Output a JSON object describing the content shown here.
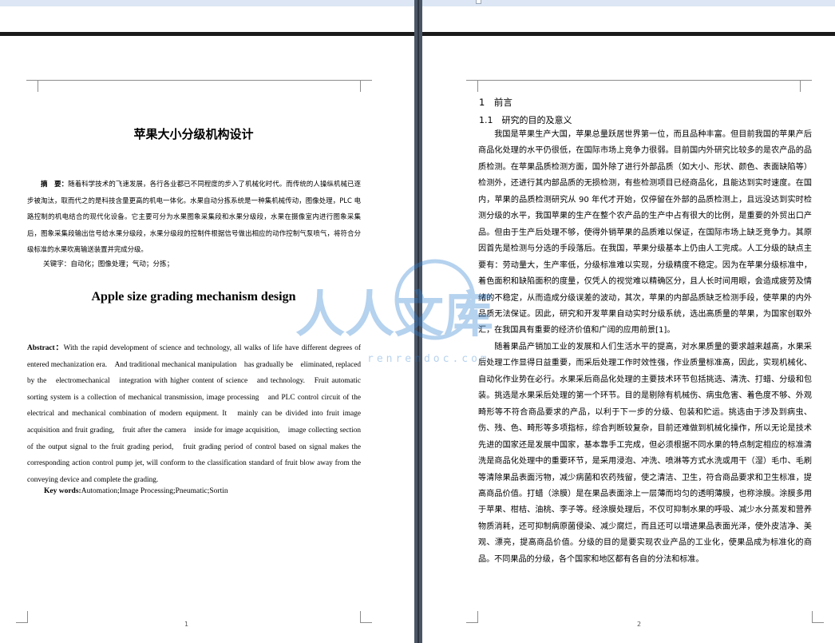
{
  "page1": {
    "title_cn": "苹果大小分级机构设计",
    "abstract_cn_label": "摘　要：",
    "abstract_cn": "随着科学技术的飞速发展，各行各业都已不同程度的步入了机械化时代。而传统的人操纵机械已逐步被淘汰，取而代之的是科技含量更高的机电一体化。水果自动分拣系统是一种集机械传动，图像处理，PLC 电路控制的机电结合的现代化设备。它主要可分为水果图象采集段和水果分级段，水果在摄像室内进行图象采集后，图象采集段输出信号给水果分级段，水果分级段的控制件根据信号做出相应的动作控制气泵喷气，将符合分级标准的水果吹离输送装置并完成分级。",
    "keywords_cn": "关键字：自动化；图像处理；气动；分拣；",
    "title_en": "Apple size grading mechanism design",
    "abstract_en_label": "Abstract：",
    "abstract_en": "With the rapid development of science and technology, all walks of life have different degrees of entered mechanization era.　And traditional mechanical manipulation　has gradually be　eliminated, replaced by the　electromechanical　integration with higher content of science　and technology.　Fruit automatic sorting system is a collection of mechanical transmission, image processing　and PLC control circuit of the electrical and mechanical combination of modern equipment. It　mainly can be divided into fruit image　acquisition and fruit grading,　fruit after the camera　inside for image acquisition,　image collecting section of the output signal to the fruit grading period,　fruit grading period of control based on signal makes the corresponding action control pump jet, will conform to the classification standard of fruit blow away from the conveying device and complete the grading.",
    "keywords_en_label": "Key words:",
    "keywords_en": "Automation;Image Processing;Pneumatic;Sortin",
    "page_number": "1"
  },
  "page2": {
    "heading1": "1　前言",
    "heading2": "1.1　研究的目的及意义",
    "para1": "我国是苹果生产大国，苹果总量跃居世界第一位，而且品种丰富。但目前我国的苹果产后商品化处理的水平仍很低，在国际市场上竞争力很弱。目前国内外研究比较多的是农产品的品质检测。在苹果品质检测方面，国外除了进行外部品质（如大小、形状、颜色、表面缺陷等）检测外，还进行其内部品质的无损检测，有些检测项目已经商品化，且能达到实时速度。在国内，苹果的品质检测研究从 90 年代才开始，仅停留在外部的品质检测上，且远没达到实时检测分级的水平，我国苹果的生产在整个农产品的生产中占有很大的比例，是重要的外贸出口产品。但由于生产后处理不够，使得外销苹果的品质难以保证，在国际市场上缺乏竞争力。其原因首先是检测与分选的手段落后。在我国，苹果分级基本上仍由人工完成。人工分级的缺点主要有：劳动量大，生产率低，分级标准难以实现，分级精度不稳定。因为在苹果分级标准中，着色面积和缺陷面积的度量，仅凭人的视觉难以精确区分，且人长时间用眼，会造成疲劳及情绪的不稳定，从而造成分级误差的波动，其次，苹果的内部品质缺乏检测手段，使苹果的内外品质无法保证。因此，研究和开发苹果自动实时分级系统，选出高质量的苹果，为国家创取外汇，在我国具有重要的经济价值和广阔的应用前景[1]。",
    "para2": "随着果品产销加工业的发展和人们生活水平的提高，对水果质量的要求越来越高，水果采后处理工作显得日益重要，而采后处理工作时效性强，作业质量标准高，因此，实现机械化、自动化作业势在必行。水果采后商品化处理的主要技术环节包括挑选、清洗、打蜡、分级和包装。挑选是水果采后处理的第一个环节。目的是剔除有机械伤、病虫危害、着色度不够、外观畸形等不符合商品要求的产品，以利于下一步的分级、包装和贮运。挑选由于涉及到病虫、伤、残、色、畸形等多项指标，综合判断较复杂，目前还难做到机械化操作，所以无论是技术先进的国家还是发展中国家，基本靠手工完成，但必须根据不同水果的特点制定相应的标准清洗是商品化处理中的重要环节，是采用浸泡、冲洗、喷淋等方式水洗或用干（湿）毛巾、毛刷等清除果品表面污物，减少病菌和农药残留，使之清洁、卫生，符合商品要求和卫生标准，提高商品价值。打蜡（涂膜）是在果品表面涂上一层薄而均匀的透明薄膜，也称涂膜。涂膜多用于苹果、柑桔、油桃、李子等。经涂膜处理后，不仅可抑制水果的呼吸、减少水分蒸发和营养物质消耗，还可抑制病原菌侵染、减少腐烂，而且还可以增进果品表面光泽，使外皮洁净、美观、漂亮，提高商品价值。分级的目的是要实现农业产品的工业化，使果品成为标准化的商品。不同果品的分级，各个国家和地区都有各自的分法和标准。",
    "page_number": "2"
  },
  "watermark": {
    "text": "人人文库",
    "url_text": "renrendoc.com",
    "color": "#2f7fd0"
  },
  "colors": {
    "page_gap": "#4a5566",
    "divider": "#1a1a1a",
    "top_ruler": "#dce6f4"
  }
}
